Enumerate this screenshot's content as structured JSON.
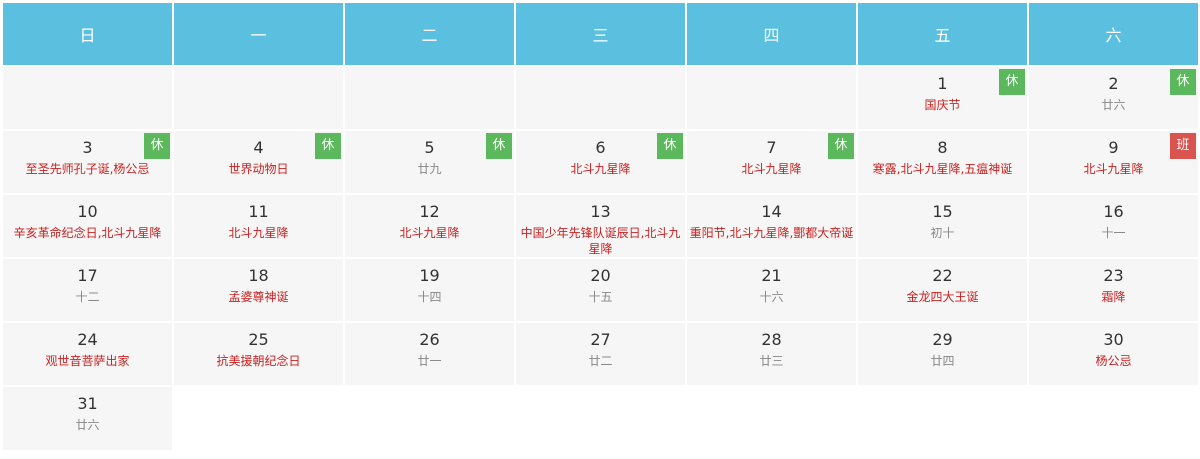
{
  "weekdays": [
    "日",
    "一",
    "二",
    "三",
    "四",
    "五",
    "六"
  ],
  "colors": {
    "header_bg": "#5bbfdf",
    "cell_bg": "#f6f6f6",
    "holiday_text": "#cc1f1f",
    "lunar_text": "#888888",
    "rest_badge": "#5cb85c",
    "work_badge": "#d9534f"
  },
  "weeks": [
    [
      {
        "day": ""
      },
      {
        "day": ""
      },
      {
        "day": ""
      },
      {
        "day": ""
      },
      {
        "day": ""
      },
      {
        "day": "1",
        "note": "国庆节",
        "holiday": true,
        "badge": "休",
        "badge_type": "rest"
      },
      {
        "day": "2",
        "note": "廿六",
        "holiday": false,
        "badge": "休",
        "badge_type": "rest"
      }
    ],
    [
      {
        "day": "3",
        "note": "至圣先师孔子诞,杨公忌",
        "holiday": true,
        "badge": "休",
        "badge_type": "rest"
      },
      {
        "day": "4",
        "note": "世界动物日",
        "holiday": true,
        "badge": "休",
        "badge_type": "rest"
      },
      {
        "day": "5",
        "note": "廿九",
        "holiday": false,
        "badge": "休",
        "badge_type": "rest"
      },
      {
        "day": "6",
        "note": "北斗九星降",
        "holiday": true,
        "badge": "休",
        "badge_type": "rest"
      },
      {
        "day": "7",
        "note": "北斗九星降",
        "holiday": true,
        "badge": "休",
        "badge_type": "rest"
      },
      {
        "day": "8",
        "note": "寒露,北斗九星降,五瘟神诞",
        "holiday": true
      },
      {
        "day": "9",
        "note": "北斗九星降",
        "holiday": true,
        "badge": "班",
        "badge_type": "work"
      }
    ],
    [
      {
        "day": "10",
        "note": "辛亥革命纪念日,北斗九星降",
        "holiday": true
      },
      {
        "day": "11",
        "note": "北斗九星降",
        "holiday": true
      },
      {
        "day": "12",
        "note": "北斗九星降",
        "holiday": true
      },
      {
        "day": "13",
        "note": "中国少年先锋队诞辰日,北斗九星降",
        "holiday": true
      },
      {
        "day": "14",
        "note": "重阳节,北斗九星降,酆都大帝诞",
        "holiday": true
      },
      {
        "day": "15",
        "note": "初十",
        "holiday": false
      },
      {
        "day": "16",
        "note": "十一",
        "holiday": false
      }
    ],
    [
      {
        "day": "17",
        "note": "十二",
        "holiday": false
      },
      {
        "day": "18",
        "note": "孟婆尊神诞",
        "holiday": true
      },
      {
        "day": "19",
        "note": "十四",
        "holiday": false
      },
      {
        "day": "20",
        "note": "十五",
        "holiday": false
      },
      {
        "day": "21",
        "note": "十六",
        "holiday": false
      },
      {
        "day": "22",
        "note": "金龙四大王诞",
        "holiday": true
      },
      {
        "day": "23",
        "note": "霜降",
        "holiday": true
      }
    ],
    [
      {
        "day": "24",
        "note": "观世音菩萨出家",
        "holiday": true
      },
      {
        "day": "25",
        "note": "抗美援朝纪念日",
        "holiday": true
      },
      {
        "day": "26",
        "note": "廿一",
        "holiday": false
      },
      {
        "day": "27",
        "note": "廿二",
        "holiday": false
      },
      {
        "day": "28",
        "note": "廿三",
        "holiday": false
      },
      {
        "day": "29",
        "note": "廿四",
        "holiday": false
      },
      {
        "day": "30",
        "note": "杨公忌",
        "holiday": true
      }
    ],
    [
      {
        "day": "31",
        "note": "廿六",
        "holiday": false
      },
      {
        "day": ""
      },
      {
        "day": ""
      },
      {
        "day": ""
      },
      {
        "day": ""
      },
      {
        "day": ""
      },
      {
        "day": ""
      }
    ]
  ]
}
